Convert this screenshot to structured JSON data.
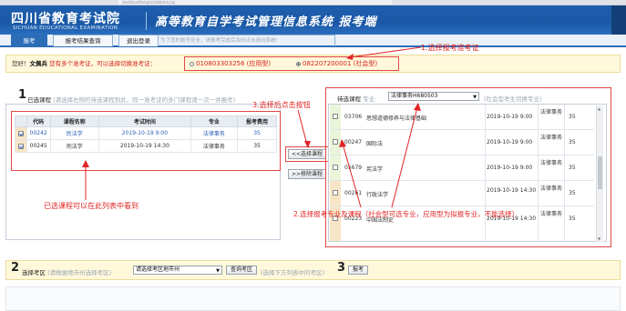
{
  "browser": {
    "address": "/test/bsxt/bmpt/ch/bbmm.jsp"
  },
  "header": {
    "logo_main": "四川省教育考试院",
    "logo_sub": "SICHUAN EDUCATIONAL EXAMINATION",
    "system_title": "高等教育自学考试管理信息系统 报考端"
  },
  "nav": {
    "tabs": [
      "报考",
      "报考结果查询",
      "退出登录"
    ],
    "tip": "为了您的账号安全，请报考完成后及时点击退出系统!"
  },
  "notice": {
    "greeting": "您好！",
    "user_name": "文佩兵",
    "message": "您有多个准考证，可以选择切换准考证：",
    "tickets": [
      {
        "label": "010803303256 (应用型)",
        "checked": false
      },
      {
        "label": "082207200001 (社会型)",
        "checked": true
      }
    ]
  },
  "selected_panel": {
    "step": "1",
    "title": "已选课程",
    "hint": "(请选择右侧的待选课程到此，同一准考证的多门课程请一次一并报考)",
    "columns": [
      "代码",
      "课程名称",
      "考试时间",
      "专业",
      "报考费用"
    ],
    "rows": [
      {
        "code": "00242",
        "name": "民法学",
        "time": "2019-10-19 9:00",
        "major": "法律事务",
        "fee": "35",
        "highlight": true
      },
      {
        "code": "00245",
        "name": "刑法学",
        "time": "2019-10-19 14:30",
        "major": "法律事务",
        "fee": "35",
        "highlight": false
      }
    ]
  },
  "buttons": {
    "select": "<<选择课程",
    "remove": ">>移除课程"
  },
  "available_panel": {
    "title": "待选课程",
    "major_label": "专业:",
    "major_value": "法律事务H680503",
    "hint": "(社会型考生切换专业)",
    "rows": [
      {
        "code": "03706",
        "name": "思想道德修养与法律基础",
        "time": "2019-10-19 9:00",
        "major": "法律事务",
        "fee": "35"
      },
      {
        "code": "00247",
        "name": "国际法",
        "time": "2019-10-19 9:00",
        "major": "法律事务",
        "fee": "35"
      },
      {
        "code": "05679",
        "name": "宪法学",
        "time": "2019-10-19 9:00",
        "major": "法律事务",
        "fee": "35"
      },
      {
        "code": "00261",
        "name": "行政法学",
        "time": "2019-10-19 14:30",
        "major": "法律事务",
        "fee": "35"
      },
      {
        "code": "00223",
        "name": "中国法制史",
        "time": "2019-10-19 14:30",
        "major": "法律事务",
        "fee": "35"
      }
    ]
  },
  "step2": {
    "step": "2",
    "label": "选择考区",
    "hint": "(请根据地市州选择考区)",
    "select_value": "请选择考区地市州",
    "query_button": "查询考区",
    "hint2": "(选择下方列表中的考区)",
    "step3": "3",
    "apply_button": "报考"
  },
  "annotations": {
    "a1": "1.选择报考准考证",
    "a2": "2.选择报考专业及课程（社会型可选专业，应用型为拟报专业，不能选择）",
    "a3": "3.选择后点击按钮",
    "a4": "已选课程可以在此列表中看到"
  },
  "colors": {
    "header_blue": "#1e5fae",
    "annotation_red": "#e02424",
    "notice_bg": "#fff8da"
  }
}
